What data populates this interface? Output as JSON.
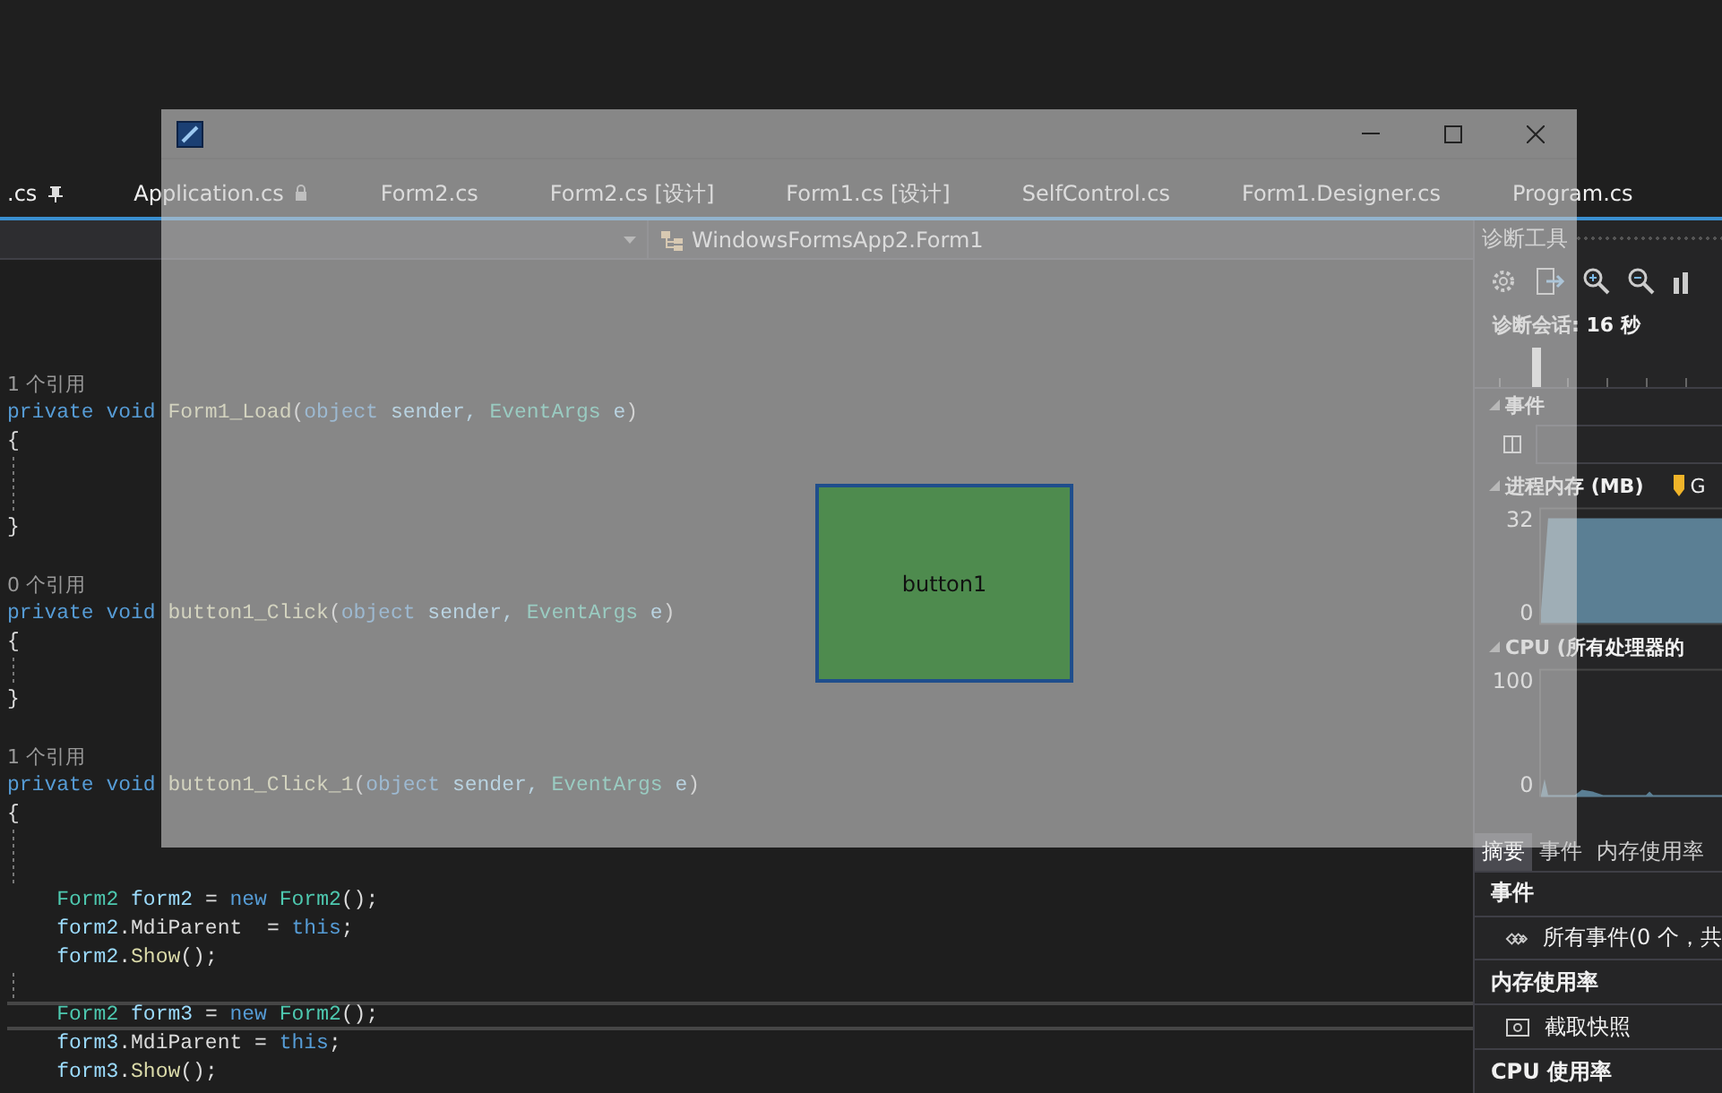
{
  "form_window": {
    "button": "button1"
  },
  "tabs": [
    {
      "label": ".cs",
      "selected": false,
      "kind": "pinned"
    },
    {
      "label": "Application.cs",
      "selected": false,
      "kind": "readonly"
    },
    {
      "label": "Form2.cs",
      "selected": false,
      "kind": "document"
    },
    {
      "label": "Form2.cs [设计]",
      "selected": false,
      "kind": "document"
    },
    {
      "label": "Form1.cs [设计]",
      "selected": false,
      "kind": "document"
    },
    {
      "label": "SelfControl.cs",
      "selected": false,
      "kind": "document"
    },
    {
      "label": "Form1.Designer.cs",
      "selected": false,
      "kind": "document"
    },
    {
      "label": "Program.cs",
      "selected": false,
      "kind": "document"
    }
  ],
  "navigation_bar": {
    "class_path": "WindowsFormsApp2.Form1"
  },
  "code_lines": [
    {
      "kind": "lens",
      "text": "1 个引用",
      "current": false
    },
    {
      "kind": "code",
      "current": false,
      "tokens": [
        {
          "kind": "keyword",
          "text": "private void "
        },
        {
          "kind": "method",
          "text": "Form1_Load"
        },
        {
          "kind": "plain",
          "text": "("
        },
        {
          "kind": "keyword",
          "text": "object"
        },
        {
          "kind": "identifier",
          "text": " sender, "
        },
        {
          "kind": "type",
          "text": "EventArgs"
        },
        {
          "kind": "identifier",
          "text": " e"
        },
        {
          "kind": "plain",
          "text": ")"
        }
      ]
    },
    {
      "kind": "code",
      "current": false,
      "tokens": [
        {
          "kind": "plain",
          "text": "{"
        }
      ]
    },
    {
      "kind": "guide",
      "current": false
    },
    {
      "kind": "guide",
      "current": false
    },
    {
      "kind": "code",
      "current": false,
      "tokens": [
        {
          "kind": "plain",
          "text": "}"
        }
      ]
    },
    {
      "kind": "blank"
    },
    {
      "kind": "lens",
      "text": "0 个引用",
      "current": false
    },
    {
      "kind": "code",
      "current": false,
      "tokens": [
        {
          "kind": "keyword",
          "text": "private void "
        },
        {
          "kind": "method",
          "text": "button1_Click"
        },
        {
          "kind": "plain",
          "text": "("
        },
        {
          "kind": "keyword",
          "text": "object"
        },
        {
          "kind": "identifier",
          "text": " sender, "
        },
        {
          "kind": "type",
          "text": "EventArgs"
        },
        {
          "kind": "identifier",
          "text": " e"
        },
        {
          "kind": "plain",
          "text": ")"
        }
      ]
    },
    {
      "kind": "code",
      "current": false,
      "tokens": [
        {
          "kind": "plain",
          "text": "{"
        }
      ]
    },
    {
      "kind": "guide",
      "current": false
    },
    {
      "kind": "code",
      "current": false,
      "tokens": [
        {
          "kind": "plain",
          "text": "}"
        }
      ]
    },
    {
      "kind": "blank"
    },
    {
      "kind": "lens",
      "text": "1 个引用",
      "current": false
    },
    {
      "kind": "code",
      "current": false,
      "tokens": [
        {
          "kind": "keyword",
          "text": "private void "
        },
        {
          "kind": "method",
          "text": "button1_Click_1"
        },
        {
          "kind": "plain",
          "text": "("
        },
        {
          "kind": "keyword",
          "text": "object"
        },
        {
          "kind": "identifier",
          "text": " sender, "
        },
        {
          "kind": "type",
          "text": "EventArgs"
        },
        {
          "kind": "identifier",
          "text": " e"
        },
        {
          "kind": "plain",
          "text": ")"
        }
      ]
    },
    {
      "kind": "code",
      "current": false,
      "tokens": [
        {
          "kind": "plain",
          "text": "{"
        }
      ]
    },
    {
      "kind": "guide",
      "current": false
    },
    {
      "kind": "guide",
      "current": false
    },
    {
      "kind": "code",
      "current": false,
      "tokens": [
        {
          "kind": "type",
          "text": "    Form2"
        },
        {
          "kind": "identifier",
          "text": " form2 "
        },
        {
          "kind": "plain",
          "text": "= "
        },
        {
          "kind": "keyword",
          "text": "new"
        },
        {
          "kind": "type",
          "text": " Form2"
        },
        {
          "kind": "plain",
          "text": "();"
        }
      ]
    },
    {
      "kind": "code",
      "current": false,
      "tokens": [
        {
          "kind": "identifier",
          "text": "    form2"
        },
        {
          "kind": "plain",
          "text": ".MdiParent  = "
        },
        {
          "kind": "keyword",
          "text": "this"
        },
        {
          "kind": "plain",
          "text": ";"
        }
      ]
    },
    {
      "kind": "code",
      "current": false,
      "tokens": [
        {
          "kind": "identifier",
          "text": "    form2"
        },
        {
          "kind": "plain",
          "text": "."
        },
        {
          "kind": "method",
          "text": "Show"
        },
        {
          "kind": "plain",
          "text": "();"
        }
      ]
    },
    {
      "kind": "guide",
      "current": false
    },
    {
      "kind": "code",
      "current": true,
      "tokens": [
        {
          "kind": "type",
          "text": "    Form2"
        },
        {
          "kind": "identifier",
          "text": " form3 "
        },
        {
          "kind": "plain",
          "text": "= "
        },
        {
          "kind": "keyword",
          "text": "new"
        },
        {
          "kind": "type",
          "text": " Form2"
        },
        {
          "kind": "plain",
          "text": "();"
        }
      ]
    },
    {
      "kind": "code",
      "current": false,
      "tokens": [
        {
          "kind": "identifier",
          "text": "    form3"
        },
        {
          "kind": "plain",
          "text": ".MdiParent = "
        },
        {
          "kind": "keyword",
          "text": "this"
        },
        {
          "kind": "plain",
          "text": ";"
        }
      ]
    },
    {
      "kind": "code",
      "current": false,
      "tokens": [
        {
          "kind": "identifier",
          "text": "    form3"
        },
        {
          "kind": "plain",
          "text": "."
        },
        {
          "kind": "method",
          "text": "Show"
        },
        {
          "kind": "plain",
          "text": "();"
        }
      ]
    }
  ],
  "diagnostics": {
    "title": "诊断工具",
    "session": "诊断会话: 16 秒",
    "events_label": "事件",
    "memory_label": "进程内存 (MB)",
    "gc_label": "G",
    "memory_axis": [
      "32",
      "0"
    ],
    "cpu_label": "CPU (所有处理器的",
    "cpu_axis": [
      "100",
      "0"
    ],
    "tabs": [
      {
        "label": "摘要",
        "selected": true
      },
      {
        "label": "事件",
        "selected": false
      },
      {
        "label": "内存使用率",
        "selected": false
      }
    ],
    "summary": [
      {
        "kind": "header",
        "text": "事件"
      },
      {
        "kind": "events",
        "text": "所有事件(0 个，共"
      },
      {
        "kind": "header",
        "text": "内存使用率"
      },
      {
        "kind": "snapshot",
        "text": "截取快照"
      },
      {
        "kind": "header",
        "text": "CPU 使用率"
      }
    ]
  }
}
